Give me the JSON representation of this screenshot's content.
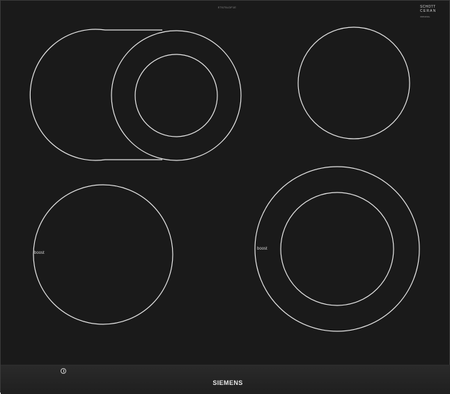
{
  "hob": {
    "model_code": "ET675LDF1E",
    "glass_brand": {
      "line1": "SCHOTT",
      "line2": "CERAN",
      "line3": "ORIGINAL"
    },
    "zones": [
      {
        "name": "back-left-extended-zone",
        "boost": false,
        "boost_label": ""
      },
      {
        "name": "back-right-zone",
        "boost": false,
        "boost_label": ""
      },
      {
        "name": "front-left-zone",
        "boost": true,
        "boost_label": "boost"
      },
      {
        "name": "front-right-dual-zone",
        "boost": true,
        "boost_label": "boost"
      }
    ],
    "brand": "SIEMENS",
    "power_icon": "power-icon",
    "colors": {
      "glass": "#1a1a1a",
      "ring": "#e8e8e8",
      "text": "#d6d6d6"
    }
  }
}
